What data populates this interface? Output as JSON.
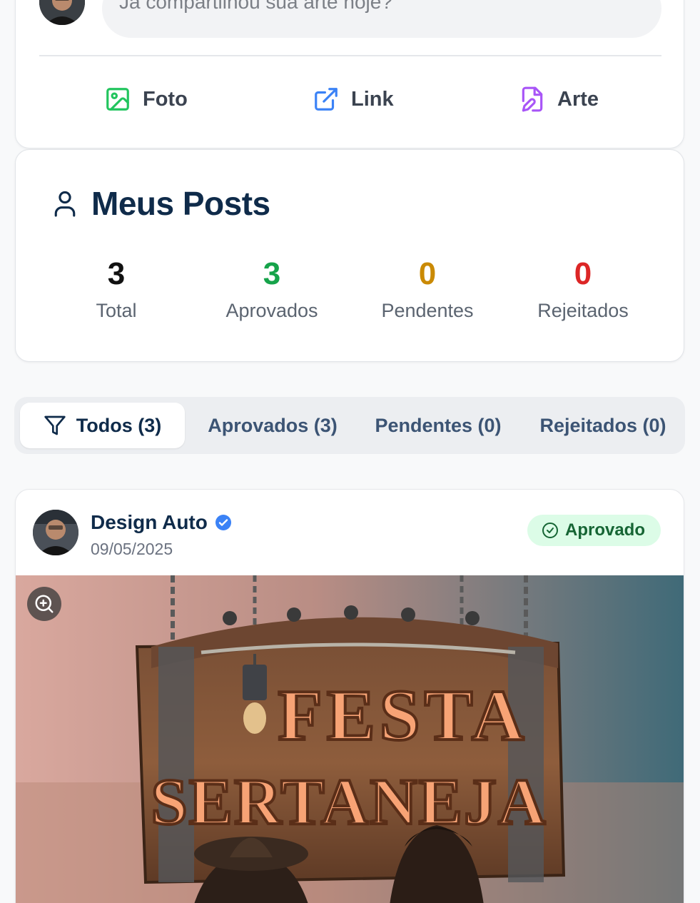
{
  "composer": {
    "placeholder": "Já compartilhou sua arte hoje?",
    "actions": [
      {
        "label": "Foto",
        "icon": "image-icon",
        "color": "#22c55e"
      },
      {
        "label": "Link",
        "icon": "external-link-icon",
        "color": "#3b82f6"
      },
      {
        "label": "Arte",
        "icon": "file-edit-icon",
        "color": "#a855f7"
      }
    ]
  },
  "my_posts": {
    "title": "Meus Posts",
    "stats": [
      {
        "value": "3",
        "label": "Total",
        "color": "#111111"
      },
      {
        "value": "3",
        "label": "Aprovados",
        "color": "#16a34a"
      },
      {
        "value": "0",
        "label": "Pendentes",
        "color": "#ca8a04"
      },
      {
        "value": "0",
        "label": "Rejeitados",
        "color": "#dc2626"
      }
    ]
  },
  "filters": {
    "tabs": [
      {
        "label": "Todos (3)",
        "active": true
      },
      {
        "label": "Aprovados (3)",
        "active": false
      },
      {
        "label": "Pendentes (0)",
        "active": false
      },
      {
        "label": "Rejeitados (0)",
        "active": false
      }
    ]
  },
  "post": {
    "author": "Design Auto",
    "date": "09/05/2025",
    "status": "Aprovado",
    "artwork_title_line1": "FESTA",
    "artwork_title_line2": "SERTANEJA"
  }
}
